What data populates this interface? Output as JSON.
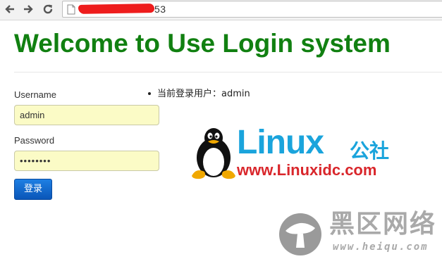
{
  "browser": {
    "url_visible": "53",
    "back_icon": "arrow-left-icon",
    "forward_icon": "arrow-right-icon",
    "reload_icon": "reload-icon",
    "page_icon": "page-icon"
  },
  "page": {
    "title": "Welcome to Use Login system",
    "title_color": "#118011"
  },
  "login_form": {
    "username_label": "Username",
    "username_value": "admin",
    "password_label": "Password",
    "password_value": "••••••••",
    "field_bg": "#fbfbc6",
    "submit_label": "登录",
    "submit_color": "#1569cf"
  },
  "status": {
    "current_user": "当前登录用户：admin"
  },
  "watermarks": {
    "linux_brand": "Linux",
    "linux_brand_cn": "公社",
    "linux_url": "www.Linuxidc.com",
    "linux_color": "#1aa4dc",
    "linux_url_color": "#d9262b",
    "heiqu_brand_cn": "黑区网络",
    "heiqu_url": "www.heiqu.com",
    "heiqu_color": "#a9a9a9"
  }
}
